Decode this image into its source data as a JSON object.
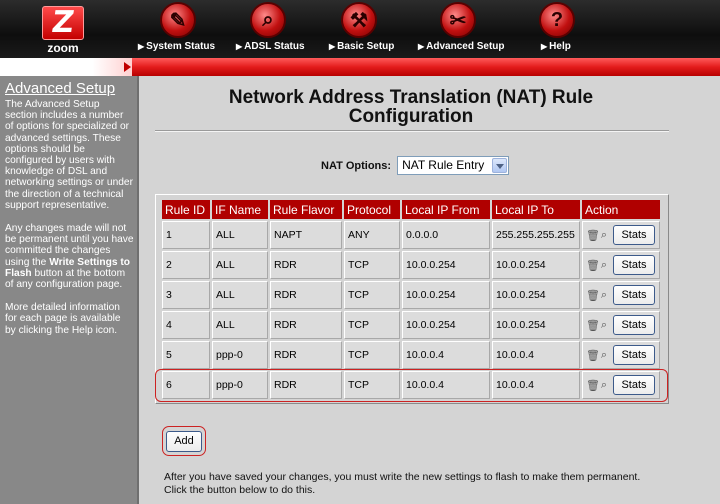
{
  "brand": {
    "name": "zoom",
    "logo_glyph": "Z"
  },
  "nav": [
    {
      "label": "System Status",
      "icon": "clipboard-pen-icon",
      "glyph": "✎"
    },
    {
      "label": "ADSL Status",
      "icon": "magnifier-icon",
      "glyph": "⌕"
    },
    {
      "label": "Basic Setup",
      "icon": "hammer-icon",
      "glyph": "⚒"
    },
    {
      "label": "Advanced Setup",
      "icon": "wrench-icon",
      "glyph": "✂"
    },
    {
      "label": "Help",
      "icon": "question-icon",
      "glyph": "?"
    }
  ],
  "sidebar": {
    "title": "Advanced Setup",
    "p1": "The Advanced Setup section includes a number of options for specialized or advanced settings. These options should be configured by users with knowledge of DSL and networking settings or under the direction of a technical support representative.",
    "p2_a": "Any changes made will not be permanent until you have committed the changes using the ",
    "p2_b": "Write Settings to Flash",
    "p2_c": " button at the bottom of any configuration page.",
    "p3": "More detailed information for each page is available by clicking the Help icon."
  },
  "page": {
    "title": "Network Address Translation (NAT) Rule Configuration",
    "nat_options_label": "NAT Options:",
    "nat_options_value": "NAT Rule Entry"
  },
  "table": {
    "headers": [
      "Rule ID",
      "IF Name",
      "Rule Flavor",
      "Protocol",
      "Local IP From",
      "Local IP To",
      "Action"
    ],
    "rows": [
      [
        "1",
        "ALL",
        "NAPT",
        "ANY",
        "0.0.0.0",
        "255.255.255.255"
      ],
      [
        "2",
        "ALL",
        "RDR",
        "TCP",
        "10.0.0.254",
        "10.0.0.254"
      ],
      [
        "3",
        "ALL",
        "RDR",
        "TCP",
        "10.0.0.254",
        "10.0.0.254"
      ],
      [
        "4",
        "ALL",
        "RDR",
        "TCP",
        "10.0.0.254",
        "10.0.0.254"
      ],
      [
        "5",
        "ppp-0",
        "RDR",
        "TCP",
        "10.0.0.4",
        "10.0.0.4"
      ],
      [
        "6",
        "ppp-0",
        "RDR",
        "TCP",
        "10.0.0.4",
        "10.0.0.4"
      ]
    ],
    "stats_label": "Stats"
  },
  "buttons": {
    "add_label": "Add"
  },
  "footer": {
    "line1": "After you have saved your changes, you must write the new settings to flash to make them permanent.",
    "line2": "Click the button below to do this."
  },
  "colors": {
    "accent": "#b00000",
    "sidebar_bg": "#888888",
    "page_bg": "#d4d4d4",
    "highlight": "#cc2222"
  }
}
